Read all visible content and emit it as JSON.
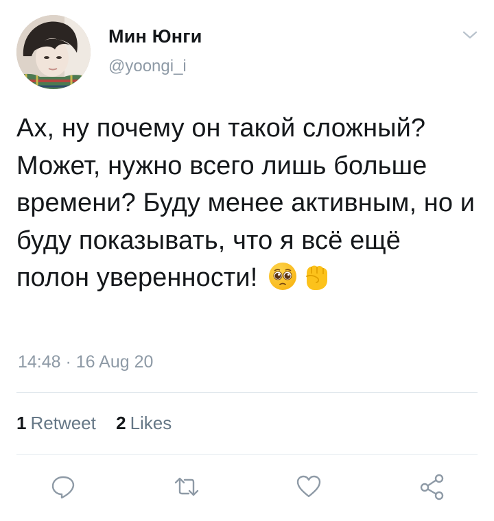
{
  "tweet": {
    "author": {
      "display_name": "Мин Юнги",
      "handle": "@yoongi_i"
    },
    "text": "Ах, ну почему он такой сложный? Может, нужно всего лишь больше времени? Буду менее активным, но и буду показывать, что я всё ещё полон уверенности!",
    "emojis": [
      "pleading-face-emoji",
      "raised-fist-emoji"
    ],
    "timestamp": "14:48 · 16 Aug 20",
    "stats": {
      "retweets_count": "1",
      "retweets_label": "Retweet",
      "likes_count": "2",
      "likes_label": "Likes"
    },
    "actions": [
      "reply-icon",
      "retweet-icon",
      "like-icon",
      "share-icon"
    ],
    "menu_icon": "chevron-down-icon"
  },
  "colors": {
    "text": "#14171a",
    "secondary": "#8e9aa6",
    "stat_label": "#657786",
    "icon": "#8e9aa6",
    "divider": "#e1e8ed"
  }
}
